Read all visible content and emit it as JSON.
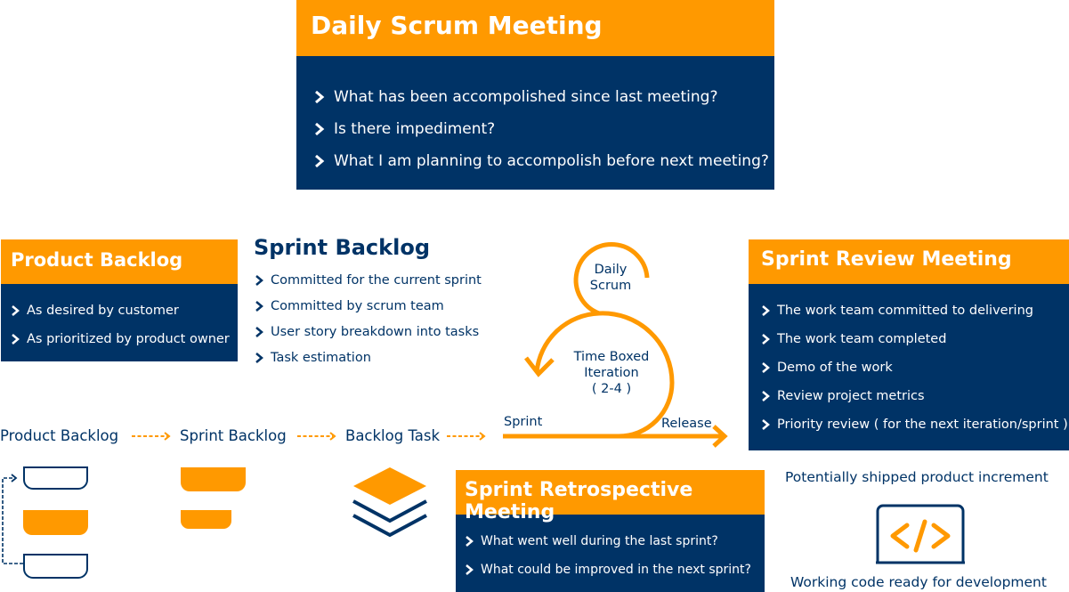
{
  "colors": {
    "accent": "#ff9900",
    "primary": "#003366",
    "background": "#ffffff"
  },
  "daily_scrum": {
    "title": "Daily Scrum Meeting",
    "items": [
      "What has been accompolished since last meeting?",
      "Is there impediment?",
      "What I am planning to accompolish before next meeting?"
    ]
  },
  "product_backlog": {
    "title": "Product Backlog",
    "items": [
      "As desired by customer",
      "As prioritized by product owner"
    ]
  },
  "sprint_backlog": {
    "title": "Sprint Backlog",
    "items": [
      "Committed for the current sprint",
      "Committed by scrum team",
      "User story breakdown into tasks",
      "Task estimation"
    ]
  },
  "cycle": {
    "daily_label_line1": "Daily",
    "daily_label_line2": "Scrum",
    "iteration_line1": "Time Boxed",
    "iteration_line2": "Iteration",
    "iteration_line3": "( 2-4 )",
    "sprint_label": "Sprint",
    "release_label": "Release"
  },
  "sprint_review": {
    "title": "Sprint Review Meeting",
    "items": [
      "The work team committed to delivering",
      "The work team completed",
      "Demo of the work",
      "Review project metrics",
      "Priority review ( for the next iteration/sprint )"
    ]
  },
  "flow": {
    "steps": [
      "Product Backlog",
      "Sprint Backlog",
      "Backlog Task"
    ]
  },
  "retrospective": {
    "title": "Sprint Retrospective Meeting",
    "items": [
      "What went well during the last sprint?",
      "What could be improved in the next sprint?"
    ]
  },
  "increment": {
    "top_label": "Potentially shipped product increment",
    "bottom_label": "Working code ready for development",
    "icon": "code-icon"
  }
}
